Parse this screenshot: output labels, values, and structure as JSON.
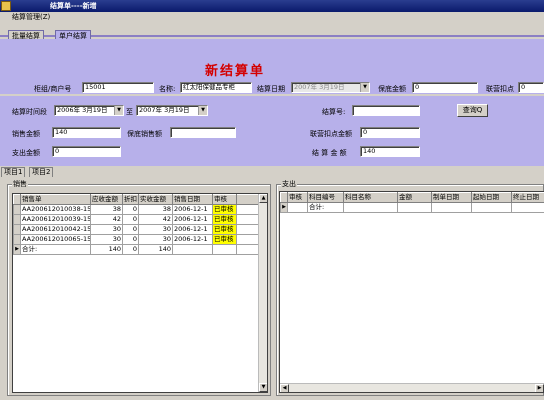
{
  "window": {
    "title": "结算单----新增"
  },
  "menu": {
    "item1": "结算管理(Z)"
  },
  "main_tabs": {
    "batch": "批量结算",
    "single": "单户结算"
  },
  "form": {
    "heading": "新结算单",
    "group_label": "柜组/商户号",
    "group_value": "15001",
    "name_label": "名称:",
    "name_value": "红太阳保健品专柜",
    "date_label": "结算日期",
    "date_value": "2007年 3月19日",
    "guarantee_label": "保底金额",
    "guarantee_value": "0",
    "deduct_label": "联营扣点",
    "deduct_value": "0",
    "period_label": "结算时间段",
    "period_from": "2006年 3月19日",
    "period_to_label": "至",
    "period_to": "2007年 3月19日",
    "settle_no_label": "结算号:",
    "settle_no_value": "",
    "query_button": "查询Q",
    "sales_amount_label": "销售金额",
    "sales_amount_value": "140",
    "guaranteed_sales_label": "保底销售额",
    "guaranteed_sales_value": "",
    "deduct_amount_label": "联营扣点金额",
    "deduct_amount_value": "0",
    "expense_label": "支出金额",
    "expense_value": "0",
    "settle_amount_label": "结 算 金 额",
    "settle_amount_value": "140"
  },
  "sub_tabs": {
    "item1": "项目1",
    "item2": "项目2"
  },
  "sales": {
    "title": "销售",
    "columns": [
      "销售单",
      "应收金额",
      "折扣",
      "实收金额",
      "销售日期",
      "审核"
    ],
    "rows": [
      [
        "AA200612010038-15",
        "38",
        "0",
        "38",
        "2006-12-1",
        "已审核"
      ],
      [
        "AA200612010039-15",
        "42",
        "0",
        "42",
        "2006-12-1",
        "已审核"
      ],
      [
        "AA200612010042-15",
        "30",
        "0",
        "30",
        "2006-12-1",
        "已审核"
      ],
      [
        "AA200612010065-15",
        "30",
        "0",
        "30",
        "2006-12-1",
        "已审核"
      ]
    ],
    "total": [
      "合计:",
      "140",
      "0",
      "140",
      "",
      ""
    ]
  },
  "expense": {
    "title": "支出",
    "columns": [
      "审核",
      "科目编号",
      "科目名称",
      "金额",
      "制单日期",
      "起始日期",
      "终止日期"
    ],
    "total_label": "合计:"
  }
}
